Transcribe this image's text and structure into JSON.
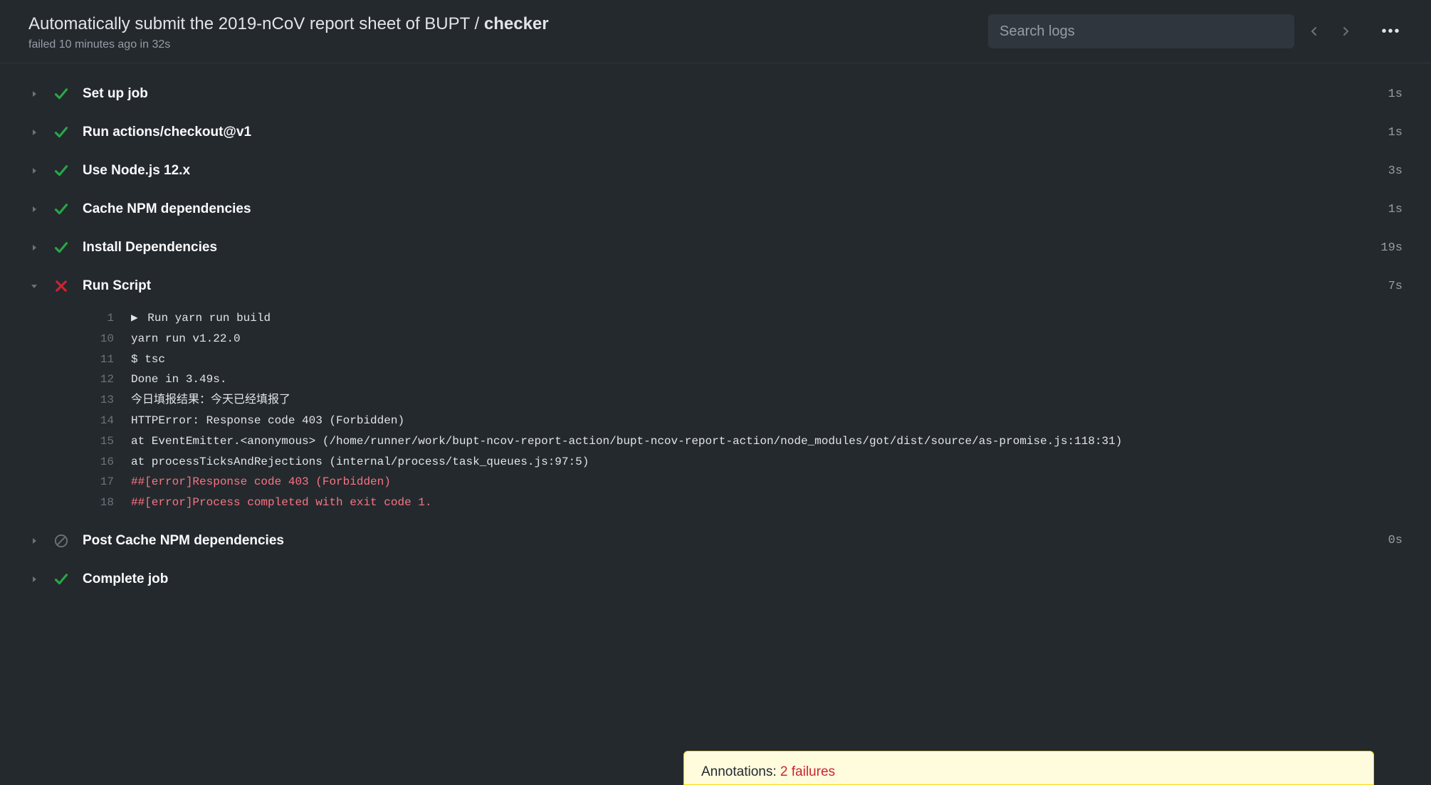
{
  "header": {
    "title_prefix": "Automatically submit the 2019-nCoV report sheet of BUPT / ",
    "title_job": "checker",
    "subtitle": "failed 10 minutes ago in 32s",
    "search_placeholder": "Search logs",
    "kebab": "•••"
  },
  "steps": [
    {
      "name": "Set up job",
      "duration": "1s",
      "status": "success",
      "expanded": false
    },
    {
      "name": "Run actions/checkout@v1",
      "duration": "1s",
      "status": "success",
      "expanded": false
    },
    {
      "name": "Use Node.js 12.x",
      "duration": "3s",
      "status": "success",
      "expanded": false
    },
    {
      "name": "Cache NPM dependencies",
      "duration": "1s",
      "status": "success",
      "expanded": false
    },
    {
      "name": "Install Dependencies",
      "duration": "19s",
      "status": "success",
      "expanded": false
    },
    {
      "name": "Run Script",
      "duration": "7s",
      "status": "failure",
      "expanded": true
    },
    {
      "name": "Post Cache NPM dependencies",
      "duration": "0s",
      "status": "skipped",
      "expanded": false
    },
    {
      "name": "Complete job",
      "duration": "",
      "status": "success",
      "expanded": false
    }
  ],
  "log_lines": [
    {
      "num": "1",
      "text": "Run yarn run build",
      "error": false,
      "group": true
    },
    {
      "num": "10",
      "text": "yarn run v1.22.0",
      "error": false
    },
    {
      "num": "11",
      "text": "$ tsc",
      "error": false
    },
    {
      "num": "12",
      "text": "Done in 3.49s.",
      "error": false
    },
    {
      "num": "13",
      "text": "今日填报结果：今天已经填报了",
      "error": false
    },
    {
      "num": "14",
      "text": "HTTPError: Response code 403 (Forbidden)",
      "error": false
    },
    {
      "num": "15",
      "text": "    at EventEmitter.<anonymous> (/home/runner/work/bupt-ncov-report-action/bupt-ncov-report-action/node_modules/got/dist/source/as-promise.js:118:31)",
      "error": false
    },
    {
      "num": "16",
      "text": "    at processTicksAndRejections (internal/process/task_queues.js:97:5)",
      "error": false
    },
    {
      "num": "17",
      "text": "##[error]Response code 403 (Forbidden)",
      "error": true
    },
    {
      "num": "18",
      "text": "##[error]Process completed with exit code 1.",
      "error": true
    }
  ],
  "annotations": {
    "label": "Annotations: ",
    "failures": "2 failures"
  }
}
